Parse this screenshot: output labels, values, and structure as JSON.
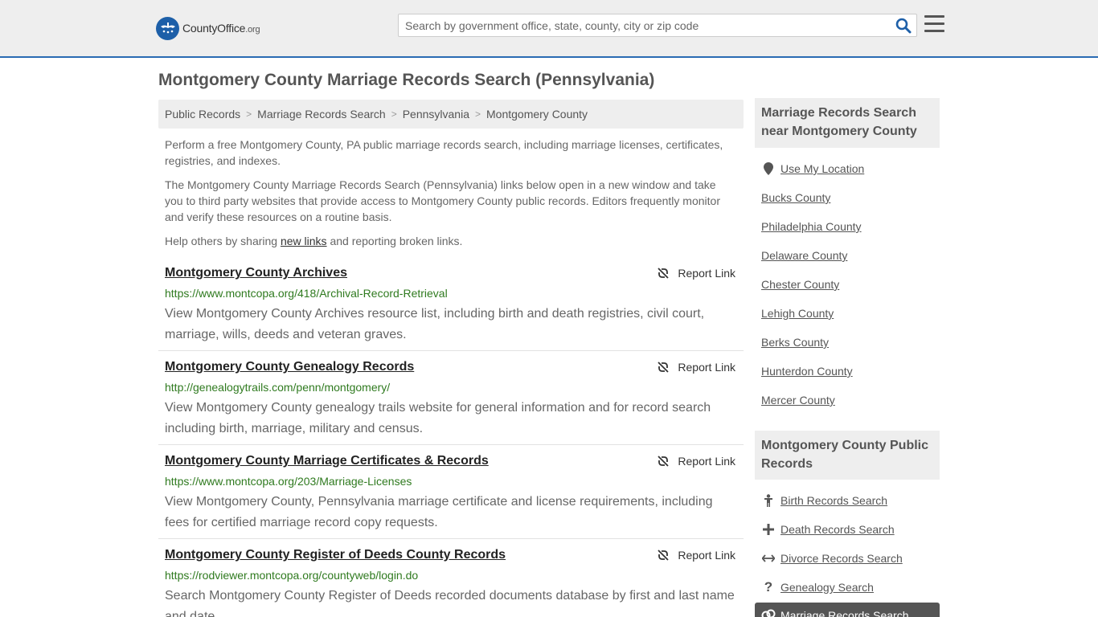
{
  "header": {
    "logo_text": "CountyOffice",
    "logo_tld": ".org",
    "search_placeholder": "Search by government office, state, county, city or zip code"
  },
  "page_title": "Montgomery County Marriage Records Search (Pennsylvania)",
  "breadcrumb": [
    "Public Records",
    "Marriage Records Search",
    "Pennsylvania",
    "Montgomery County"
  ],
  "intro": {
    "p1": "Perform a free Montgomery County, PA public marriage records search, including marriage licenses, certificates, registries, and indexes.",
    "p2": "The Montgomery County Marriage Records Search (Pennsylvania) links below open in a new window and take you to third party websites that provide access to Montgomery County public records. Editors frequently monitor and verify these resources on a routine basis.",
    "p3_before": "Help others by sharing ",
    "p3_link": "new links",
    "p3_after": " and reporting broken links."
  },
  "report_label": "Report Link",
  "results": [
    {
      "title": "Montgomery County Archives",
      "url": "https://www.montcopa.org/418/Archival-Record-Retrieval",
      "desc": "View Montgomery County Archives resource list, including birth and death registries, civil court, marriage, wills, deeds and veteran graves."
    },
    {
      "title": "Montgomery County Genealogy Records",
      "url": "http://genealogytrails.com/penn/montgomery/",
      "desc": "View Montgomery County genealogy trails website for general information and for record search including birth, marriage, military and census."
    },
    {
      "title": "Montgomery County Marriage Certificates & Records",
      "url": "https://www.montcopa.org/203/Marriage-Licenses",
      "desc": "View Montgomery County, Pennsylvania marriage certificate and license requirements, including fees for certified marriage record copy requests."
    },
    {
      "title": "Montgomery County Register of Deeds County Records",
      "url": "https://rodviewer.montcopa.org/countyweb/login.do",
      "desc": "Search Montgomery County Register of Deeds recorded documents database by first and last name and date."
    }
  ],
  "sidebar": {
    "nearby_heading": "Marriage Records Search near Montgomery County",
    "use_location": "Use My Location",
    "nearby": [
      "Bucks County",
      "Philadelphia County",
      "Delaware County",
      "Chester County",
      "Lehigh County",
      "Berks County",
      "Hunterdon County",
      "Mercer County"
    ],
    "public_heading": "Montgomery County Public Records",
    "public_links": [
      {
        "label": "Birth Records Search",
        "icon": "child-icon"
      },
      {
        "label": "Death Records Search",
        "icon": "cross-icon"
      },
      {
        "label": "Divorce Records Search",
        "icon": "arrows-icon"
      },
      {
        "label": "Genealogy Search",
        "icon": "question-icon"
      },
      {
        "label": "Marriage Records Search",
        "icon": "rings-icon"
      }
    ]
  },
  "colors": {
    "accent": "#2a6bb3",
    "url_green": "#2f7a1f",
    "header_bg": "#eeeeee",
    "active_bg": "#555555"
  }
}
